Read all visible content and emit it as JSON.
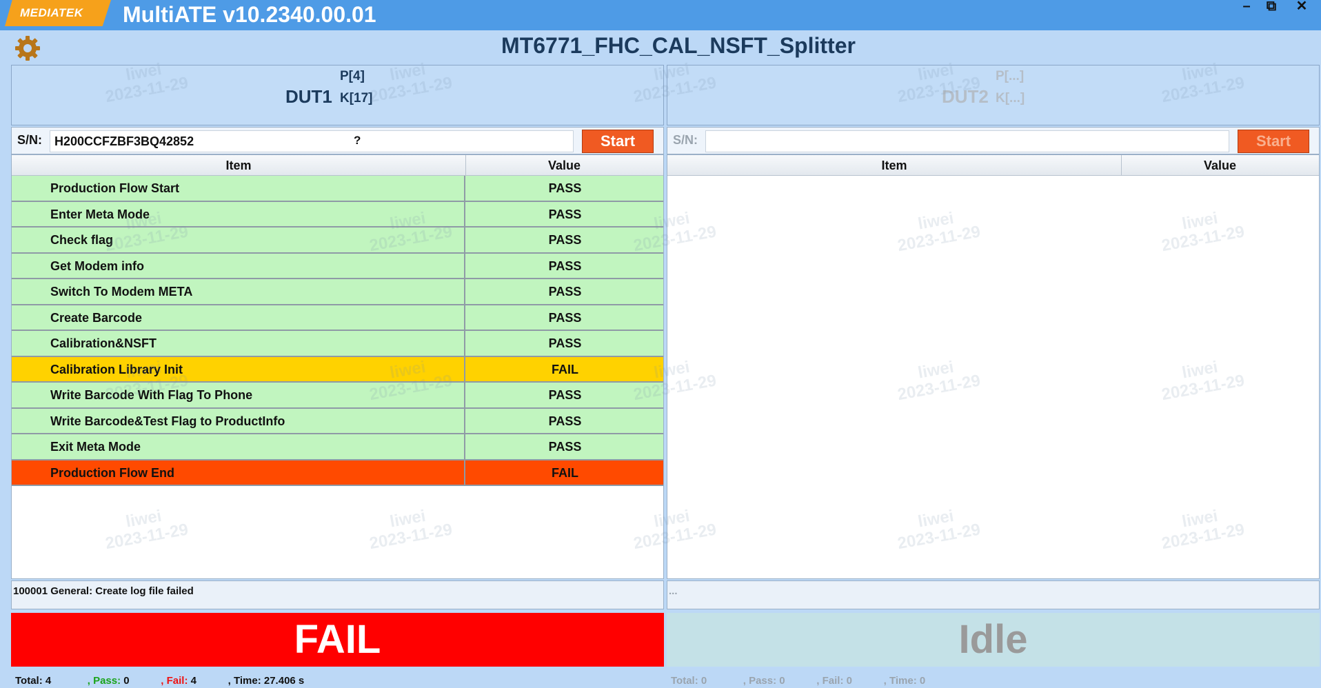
{
  "titlebar": {
    "logo": "MEDIATEK",
    "app_title": "MultiATE v10.2340.00.01",
    "minimize": "–",
    "maximize": "⧉",
    "close": "✕"
  },
  "header": {
    "title": "MT6771_FHC_CAL_NSFT_Splitter",
    "settings_icon": "gear-icon"
  },
  "watermark": {
    "name": "liwei",
    "date": "2023-11-29"
  },
  "colors": {
    "pass_row": "#c1f5bf",
    "fail_row": "#ffd200",
    "end_fail_row": "#ff4a00",
    "fail_banner": "#ff0000",
    "idle_banner": "#c4e1e7",
    "start_button": "#f05a22"
  },
  "dut1": {
    "name": "DUT1",
    "p": "P[4]",
    "k": "K[17]",
    "sn_label": "S/N:",
    "sn_value": "H200CCFZBF3BQ42852",
    "sn_extra": "?",
    "start": "Start",
    "col_item": "Item",
    "col_value": "Value",
    "rows": [
      {
        "item": "Production Flow Start",
        "value": "PASS",
        "status": "pass"
      },
      {
        "item": "Enter Meta Mode",
        "value": "PASS",
        "status": "pass"
      },
      {
        "item": "Check flag",
        "value": "PASS",
        "status": "pass"
      },
      {
        "item": "Get Modem info",
        "value": "PASS",
        "status": "pass"
      },
      {
        "item": "Switch To Modem META",
        "value": "PASS",
        "status": "pass"
      },
      {
        "item": "Create Barcode",
        "value": "PASS",
        "status": "pass"
      },
      {
        "item": "Calibration&NSFT",
        "value": "PASS",
        "status": "pass"
      },
      {
        "item": "Calibration Library Init",
        "value": "FAIL",
        "status": "fail"
      },
      {
        "item": "Write Barcode With Flag To Phone",
        "value": "PASS",
        "status": "pass"
      },
      {
        "item": "Write Barcode&Test Flag to ProductInfo",
        "value": "PASS",
        "status": "pass"
      },
      {
        "item": "Exit Meta Mode",
        "value": "PASS",
        "status": "pass"
      },
      {
        "item": "Production Flow End",
        "value": "FAIL",
        "status": "end-fail"
      }
    ],
    "message": "100001 General: Create log file failed",
    "result": "FAIL",
    "stats": {
      "total_label": "Total:",
      "total": "4",
      "pass_label": ", Pass:",
      "pass": "0",
      "fail_label": ", Fail:",
      "fail": "4",
      "time_label": ", Time:",
      "time": "27.406 s"
    }
  },
  "dut2": {
    "name": "DUT2",
    "p": "P[...]",
    "k": "K[...]",
    "sn_label": "S/N:",
    "sn_value": "",
    "start": "Start",
    "col_item": "Item",
    "col_value": "Value",
    "message": "...",
    "result": "Idle",
    "stats": {
      "total_label": "Total:",
      "total": "0",
      "pass_label": ", Pass:",
      "pass": "0",
      "fail_label": ", Fail:",
      "fail": "0",
      "time_label": ", Time:",
      "time": "0"
    }
  }
}
